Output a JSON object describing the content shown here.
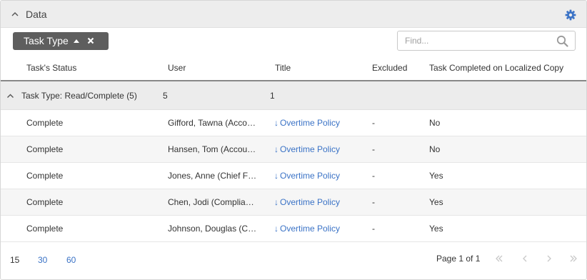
{
  "panel": {
    "title": "Data"
  },
  "toolbar": {
    "group_chip_label": "Task Type",
    "find_placeholder": "Find..."
  },
  "icons": {
    "collapse": "chevron-up-icon",
    "settings": "gear-icon",
    "sort": "sort-ascending-icon",
    "remove": "close-icon",
    "search": "search-icon",
    "group_toggle": "chevron-up-icon",
    "download": "download-arrow-icon",
    "first_page": "double-chevron-left-icon",
    "prev_page": "chevron-left-icon",
    "next_page": "chevron-right-icon",
    "last_page": "double-chevron-right-icon"
  },
  "colors": {
    "header_bg": "#ededed",
    "chip_bg": "#5e5e5e",
    "link": "#3b73c6",
    "gear": "#3b73c6",
    "group_row_bg": "#ececec",
    "alt_row_bg": "#f6f6f6"
  },
  "table": {
    "columns": [
      "Task's Status",
      "User",
      "Title",
      "Excluded",
      "Task Completed on Localized Copy"
    ],
    "group": {
      "label": "Task Type: Read/Complete (5)",
      "user_count": "5",
      "title_count": "1"
    },
    "download_glyph": "↓",
    "rows": [
      {
        "status": "Complete",
        "user": "Gifford, Tawna (Accounting)",
        "title": "Overtime Policy",
        "excluded": "-",
        "localized": "No"
      },
      {
        "status": "Complete",
        "user": "Hansen, Tom (Accounting)",
        "title": "Overtime Policy",
        "excluded": "-",
        "localized": "No"
      },
      {
        "status": "Complete",
        "user": "Jones, Anne (Chief Financial Officer)",
        "title": "Overtime Policy",
        "excluded": "-",
        "localized": "Yes"
      },
      {
        "status": "Complete",
        "user": "Chen, Jodi (Compliance)",
        "title": "Overtime Policy",
        "excluded": "-",
        "localized": "Yes"
      },
      {
        "status": "Complete",
        "user": "Johnson, Douglas (Compliance)",
        "title": "Overtime Policy",
        "excluded": "-",
        "localized": "Yes"
      }
    ]
  },
  "footer": {
    "page_sizes": [
      "15",
      "30",
      "60"
    ],
    "current_page_size": "15",
    "page_info": "Page 1 of 1"
  }
}
